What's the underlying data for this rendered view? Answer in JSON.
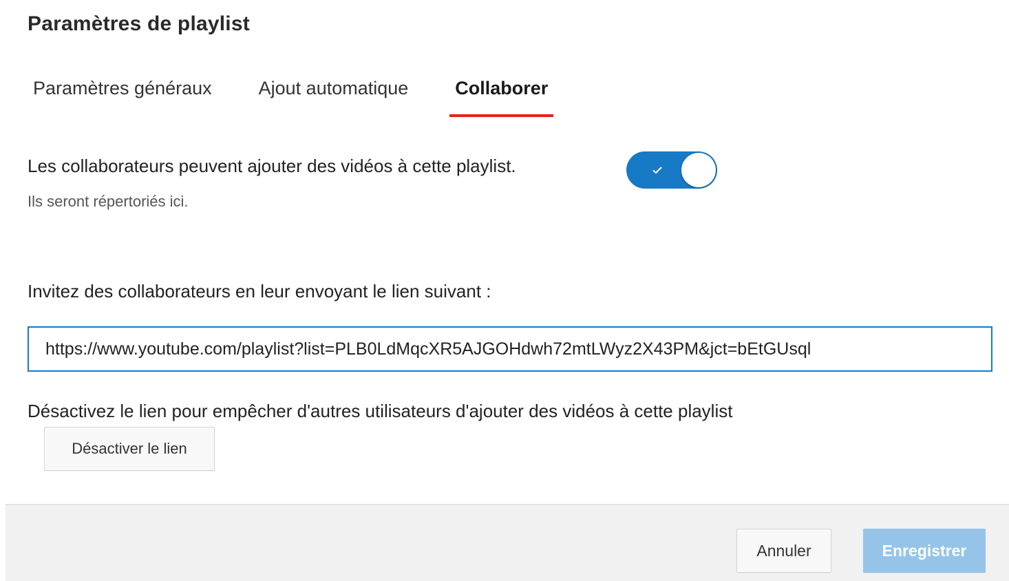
{
  "dialog": {
    "title": "Paramètres de playlist"
  },
  "tabs": [
    {
      "label": "Paramètres généraux",
      "active": false
    },
    {
      "label": "Ajout automatique",
      "active": false
    },
    {
      "label": "Collaborer",
      "active": true
    }
  ],
  "collaborate": {
    "toggle_label": "Les collaborateurs peuvent ajouter des vidéos à cette playlist.",
    "toggle_sublabel": "Ils seront répertoriés ici.",
    "toggle_on": true,
    "toggle_icon": "check-icon",
    "invite_label": "Invitez des collaborateurs en leur envoyant le lien suivant :",
    "invite_link": "https://www.youtube.com/playlist?list=PLB0LdMqcXR5AJGOHdwh72mtLWyz2X43PM&jct=bEtGUsql",
    "disable_text": "Désactivez le lien pour empêcher d'autres utilisateurs d'ajouter des vidéos à cette playlist",
    "disable_button": "Désactiver le lien"
  },
  "footer": {
    "cancel_label": "Annuler",
    "save_label": "Enregistrer"
  },
  "colors": {
    "accent_blue": "#167ac6",
    "tab_underline_red": "#e62117",
    "save_disabled": "#95c4e8"
  }
}
